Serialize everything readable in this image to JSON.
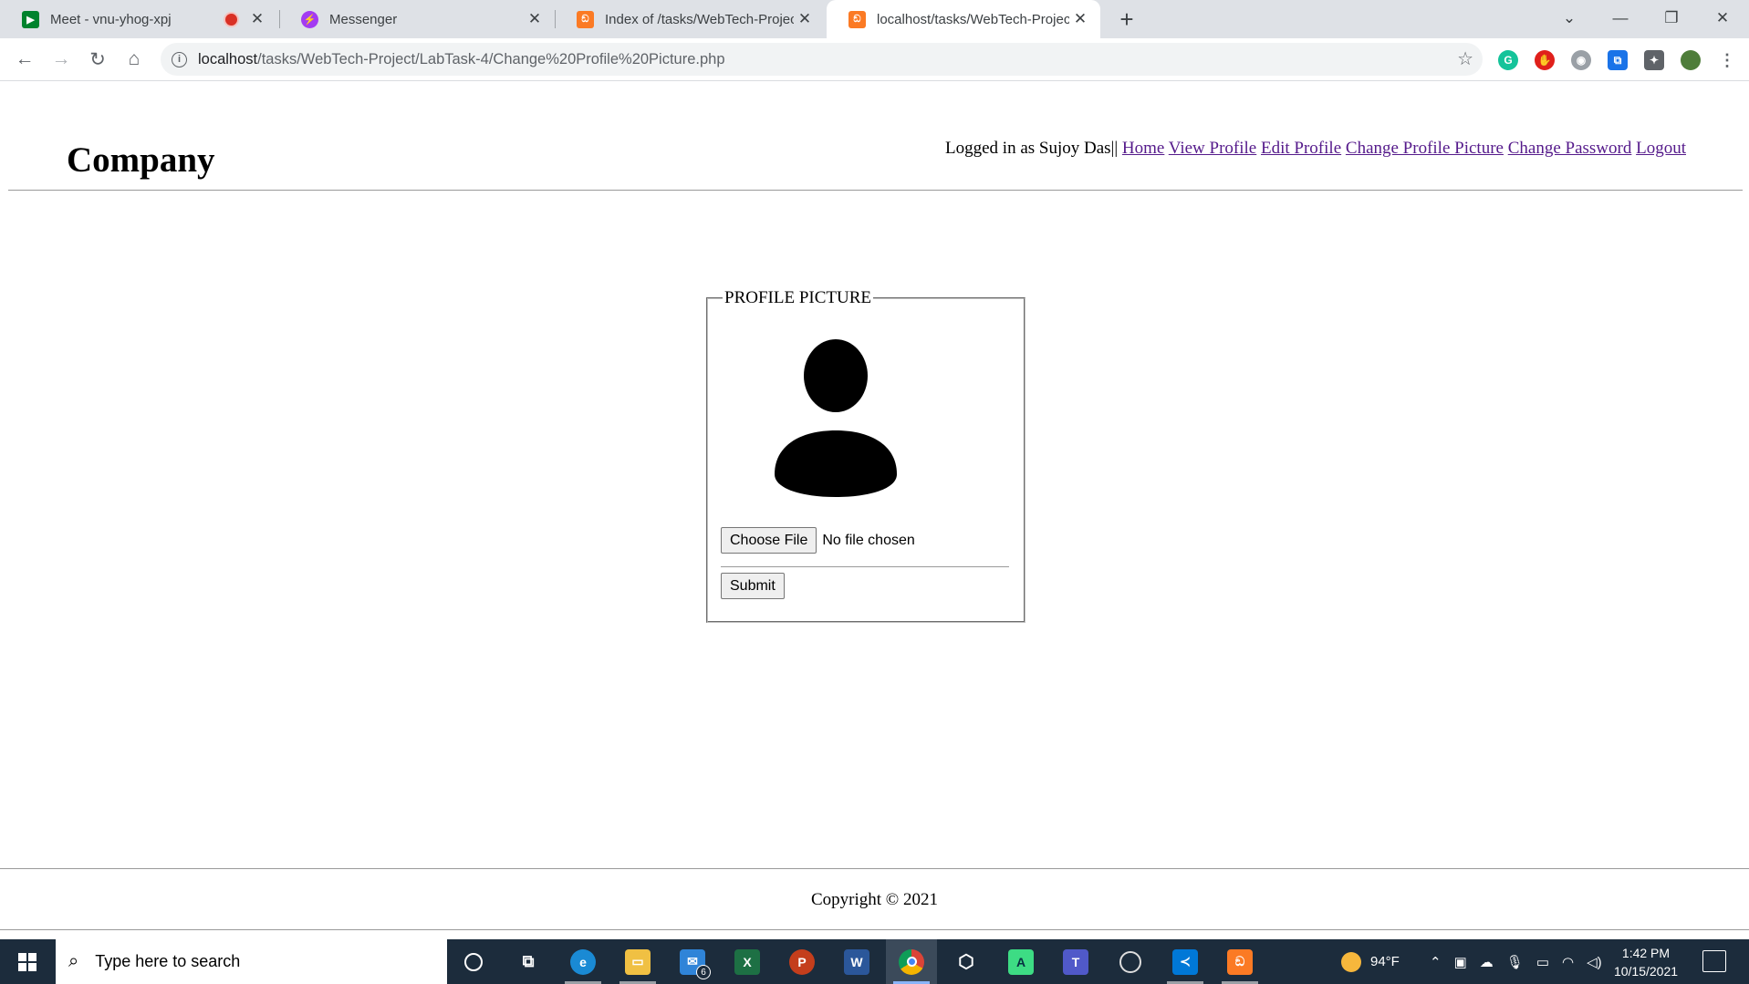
{
  "browser": {
    "tabs": [
      {
        "title": "Meet - vnu-yhog-xpj",
        "favicon": "google-meet-icon",
        "recording": true
      },
      {
        "title": "Messenger",
        "favicon": "messenger-icon"
      },
      {
        "title": "Index of /tasks/WebTech-Project/",
        "favicon": "xampp-icon"
      },
      {
        "title": "localhost/tasks/WebTech-Project/",
        "favicon": "xampp-icon",
        "active": true
      }
    ],
    "url_host": "localhost",
    "url_path": "/tasks/WebTech-Project/LabTask-4/Change%20Profile%20Picture.php"
  },
  "page": {
    "brand": "Company",
    "logged_in_text": "Logged in as Sujoy Das||",
    "nav": {
      "home": "Home",
      "view_profile": "View Profile",
      "edit_profile": "Edit Profile",
      "change_picture": "Change Profile Picture",
      "change_password": "Change Password",
      "logout": "Logout"
    },
    "form": {
      "legend": "PROFILE PICTURE",
      "choose_file": "Choose File",
      "file_status": "No file chosen",
      "submit": "Submit"
    },
    "footer": "Copyright © 2021"
  },
  "taskbar": {
    "search_placeholder": "Type here to search",
    "mail_badge": "6",
    "weather": "94°F",
    "time": "1:42 PM",
    "date": "10/15/2021"
  },
  "colors": {
    "link": "#551a8b",
    "tabstrip": "#dee1e6",
    "taskbar": "#1c2c3c"
  }
}
